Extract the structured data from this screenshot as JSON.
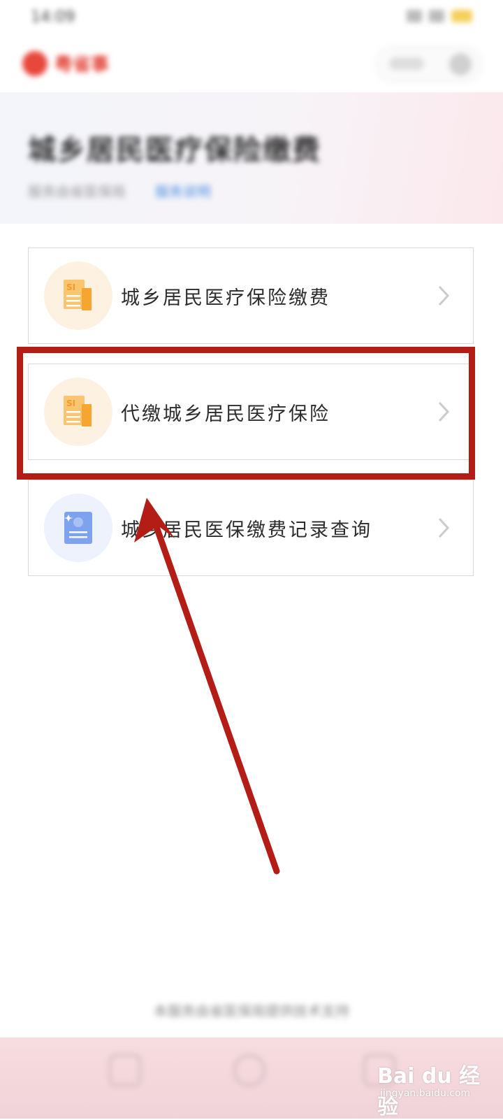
{
  "status_bar": {
    "time": "14:09",
    "battery_color": "#f5cf59"
  },
  "header": {
    "app_name": "粤省事"
  },
  "banner": {
    "title": "城乡居民医疗保险缴费",
    "subtitle": "服务由省医保局",
    "link": "服务说明"
  },
  "menu": {
    "items": [
      {
        "label": "城乡居民医疗保险缴费",
        "icon": "document-si-icon",
        "icon_bg": "#fdf2e2"
      },
      {
        "label": "代缴城乡居民医疗保险",
        "icon": "document-si-icon",
        "icon_bg": "#fdf2e2"
      },
      {
        "label": "城乡居民医保缴费记录查询",
        "icon": "record-book-icon",
        "icon_bg": "#eef2fd"
      }
    ]
  },
  "annotation": {
    "highlight_color": "#b31d16",
    "highlighted_item": "代缴城乡居民医疗保险"
  },
  "footer": {
    "note": "本服务由省医保局提供技术支持"
  },
  "watermark": {
    "brand": "Bai du 经验",
    "url": "jingyan.baidu.com"
  }
}
